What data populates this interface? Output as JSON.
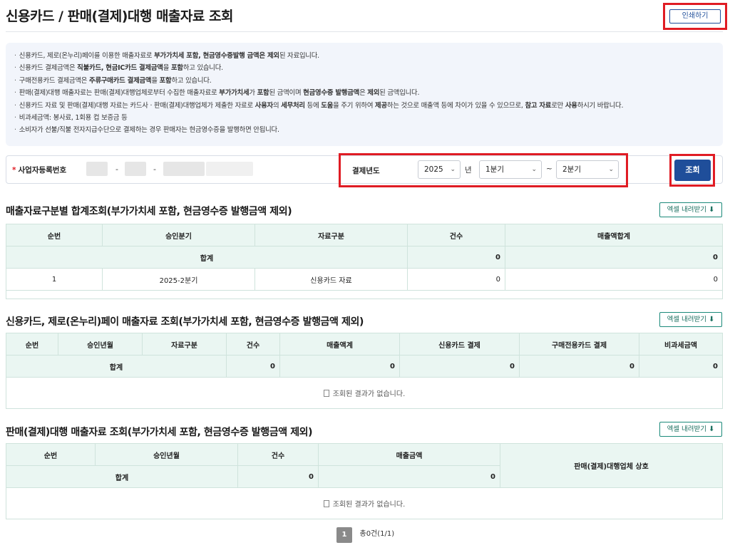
{
  "header": {
    "title": "신용카드 / 판매(결제)대행 매출자료 조회",
    "print_label": "인쇄하기"
  },
  "notice": {
    "items": [
      [
        "신용카드, 제로(온누리)페이를 이용한 매출자료로 ",
        {
          "b": "부가가치세 포함, 현금영수증발행 금액은 제외"
        },
        "된 자료입니다."
      ],
      [
        "신용카드 결제금액은 ",
        {
          "b": "직불카드, 현금IC카드 결제금액"
        },
        "을 ",
        {
          "b": "포함"
        },
        "하고 있습니다."
      ],
      [
        "구매전용카드 결제금액은 ",
        {
          "b": "주류구매카드 결제금액"
        },
        "을 ",
        {
          "b": "포함"
        },
        "하고 있습니다."
      ],
      [
        "판매(결제)대행 매출자료는 판매(결제)대행업체로부터 수집한 매출자료로 ",
        {
          "b": "부가가치세"
        },
        "가 ",
        {
          "b": "포함"
        },
        "된 금액이며 ",
        {
          "b": "현금영수증 발행금액"
        },
        "은 ",
        {
          "b": "제외"
        },
        "된 금액입니다."
      ],
      [
        "신용카드 자료 및 판매(결제)대행 자료는 카드사 · 판매(결제)대행업체가 제출한 자료로 ",
        {
          "b": "사용자"
        },
        "의 ",
        {
          "b": "세무처리"
        },
        " 등에 ",
        {
          "b": "도움"
        },
        "을 주기 위하여 ",
        {
          "b": "제공"
        },
        "하는 것으로 매출액 등에 차이가 있을 수 있으므로, ",
        {
          "b": "참고 자료"
        },
        "로만 ",
        {
          "b": "사용"
        },
        "하시기 바랍니다."
      ],
      [
        "비과세금액: 봉사료, 1회용 컵 보증금 등"
      ],
      [
        "소비자가 선불/직불 전자지급수단으로 결제하는 경우 판매자는 현금영수증을 발행하면 안됩니다."
      ]
    ]
  },
  "search": {
    "biz_label": "사업자등록번호",
    "dash": "-",
    "year_label": "결제년도",
    "year_value": "2025",
    "year_unit": "년",
    "from_quarter": "1분기",
    "tilde": "~",
    "to_quarter": "2분기",
    "query_label": "조회"
  },
  "excel_label": "엑셀 내려받기",
  "empty_message": "조회된 결과가 없습니다.",
  "section1": {
    "title": "매출자료구분별 합계조회(부가가치세 포함, 현금영수증 발행금액 제외)",
    "headers": [
      "순번",
      "승인분기",
      "자료구분",
      "건수",
      "매출액합계"
    ],
    "total": {
      "label": "합계",
      "count": "0",
      "amount": "0"
    },
    "rows": [
      {
        "no": "1",
        "quarter": "2025-2분기",
        "type": "신용카드 자료",
        "count": "0",
        "amount": "0"
      }
    ]
  },
  "section2": {
    "title": "신용카드, 제로(온누리)페이 매출자료 조회(부가가치세 포함, 현금영수증 발행금액 제외)",
    "headers": [
      "순번",
      "승인년월",
      "자료구분",
      "건수",
      "매출액계",
      "신용카드 결제",
      "구매전용카드 결제",
      "비과세금액"
    ],
    "total": {
      "label": "합계",
      "count": "0",
      "sales": "0",
      "credit": "0",
      "purchase": "0",
      "taxfree": "0"
    }
  },
  "section3": {
    "title": "판매(결제)대행 매출자료 조회(부가가치세 포함, 현금영수증 발행금액 제외)",
    "headers": [
      "순번",
      "승인년월",
      "건수",
      "매출금액",
      "판매(결제)대행업체 상호"
    ],
    "total": {
      "label": "합계",
      "count": "0",
      "amount": "0"
    }
  },
  "pager": {
    "page": "1",
    "summary": "총0건(1/1)"
  }
}
